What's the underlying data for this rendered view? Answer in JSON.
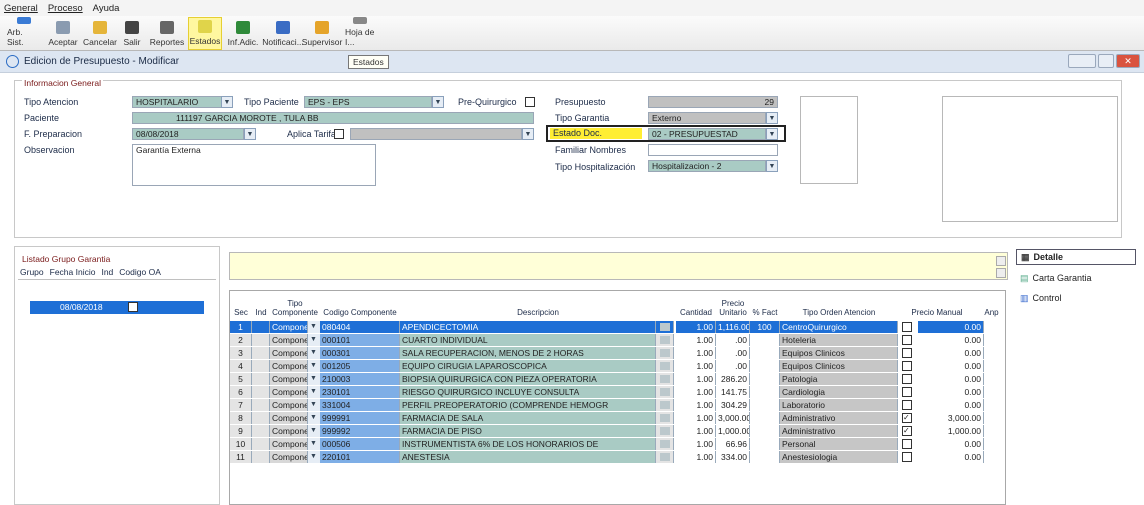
{
  "menu": [
    "General",
    "Proceso",
    "Ayuda"
  ],
  "toolbar": [
    {
      "label": "Arb. Sist.",
      "icon": "tree-icon",
      "color": "#3a7bd5"
    },
    {
      "label": "Aceptar",
      "icon": "accept-icon",
      "color": "#8a9bb0"
    },
    {
      "label": "Cancelar",
      "icon": "undo-icon",
      "color": "#e5b53a"
    },
    {
      "label": "Salir",
      "icon": "exit-icon",
      "color": "#444"
    },
    {
      "label": "Reportes",
      "icon": "report-icon",
      "color": "#666"
    },
    {
      "label": "Estados",
      "icon": "states-icon",
      "color": "#e0d44a",
      "active": true
    },
    {
      "label": "Inf.Adic.",
      "icon": "info-grid-icon",
      "color": "#2f8a3a"
    },
    {
      "label": "Notificaci...",
      "icon": "notification-icon",
      "color": "#3a6cc4"
    },
    {
      "label": "Supervisor",
      "icon": "supervisor-icon",
      "color": "#e5a42a"
    },
    {
      "label": "Hoja de I...",
      "icon": "sheet-icon",
      "color": "#888"
    }
  ],
  "window": {
    "title": "Edicion de Presupuesto - Modificar",
    "tooltip": "Estados"
  },
  "info": {
    "group_title": "Informacion General",
    "tipo_atencion_label": "Tipo Atencion",
    "tipo_atencion": "HOSPITALARIO",
    "tipo_paciente_label": "Tipo Paciente",
    "tipo_paciente": "EPS - EPS",
    "pre_quirurgico_label": "Pre-Quirurgico",
    "paciente_label": "Paciente",
    "paciente_id": "111197",
    "paciente_nombre": "GARCIA MOROTE , TULA BB",
    "f_preparacion_label": "F. Preparacion",
    "f_preparacion": "08/08/2018",
    "aplica_tarifa_label": "Aplica Tarifa",
    "observacion_label": "Observacion",
    "observacion": "Garantía Externa",
    "presupuesto_label": "Presupuesto",
    "presupuesto": "29",
    "tipo_garantia_label": "Tipo Garantia",
    "tipo_garantia": "Externo",
    "estado_doc_label": "Estado Doc.",
    "estado_doc": "02 - PRESUPUESTAD",
    "familiar_label": "Familiar Nombres",
    "familiar": "",
    "tipo_hosp_label": "Tipo Hospitalización",
    "tipo_hosp": "Hospitalizacion - 2"
  },
  "left": {
    "title": "Listado Grupo Garantia",
    "headers": [
      "Grupo",
      "Fecha Inicio",
      "Ind",
      "Codigo OA"
    ],
    "row_date": "08/08/2018"
  },
  "grid": {
    "headers": [
      "Sec",
      "Ind",
      "Tipo Componente",
      "Codigo Componente",
      "Descripcion",
      "Cantidad",
      "Precio Unitario",
      "% Fact",
      "Tipo Orden Atencion",
      "Precio Manual",
      "Anp"
    ],
    "rows": [
      {
        "sec": "1",
        "tipo": "Componen",
        "codigo": "080404",
        "desc": "APENDICECTOMIA",
        "cant": "1.00",
        "precio": "1,116.00",
        "fact": "100",
        "orden": "CentroQuirurgico",
        "manual": false,
        "monto": "0.00"
      },
      {
        "sec": "2",
        "tipo": "Componen",
        "codigo": "000101",
        "desc": "CUARTO INDIVIDUAL",
        "cant": "1.00",
        "precio": ".00",
        "fact": "",
        "orden": "Hoteleria",
        "manual": false,
        "monto": "0.00"
      },
      {
        "sec": "3",
        "tipo": "Componen",
        "codigo": "000301",
        "desc": "SALA RECUPERACION, MENOS DE 2 HORAS",
        "cant": "1.00",
        "precio": ".00",
        "fact": "",
        "orden": "Equipos Clinicos",
        "manual": false,
        "monto": "0.00"
      },
      {
        "sec": "4",
        "tipo": "Componen",
        "codigo": "001205",
        "desc": "EQUIPO CIRUGIA LAPAROSCOPICA",
        "cant": "1.00",
        "precio": ".00",
        "fact": "",
        "orden": "Equipos Clinicos",
        "manual": false,
        "monto": "0.00"
      },
      {
        "sec": "5",
        "tipo": "Componen",
        "codigo": "210003",
        "desc": "BIOPSIA QUIRURGICA CON PIEZA OPERATORIA",
        "cant": "1.00",
        "precio": "286.20",
        "fact": "",
        "orden": "Patologia",
        "manual": false,
        "monto": "0.00"
      },
      {
        "sec": "6",
        "tipo": "Componen",
        "codigo": "230101",
        "desc": "RIESGO QUIRURGICO INCLUYE CONSULTA",
        "cant": "1.00",
        "precio": "141.75",
        "fact": "",
        "orden": "Cardiologia",
        "manual": false,
        "monto": "0.00"
      },
      {
        "sec": "7",
        "tipo": "Componen",
        "codigo": "331004",
        "desc": "PERFIL PREOPERATORIO (COMPRENDE HEMOGR",
        "cant": "1.00",
        "precio": "304.29",
        "fact": "",
        "orden": "Laboratorio",
        "manual": false,
        "monto": "0.00"
      },
      {
        "sec": "8",
        "tipo": "Componen",
        "codigo": "999991",
        "desc": "FARMACIA DE SALA",
        "cant": "1.00",
        "precio": "3,000.00",
        "fact": "",
        "orden": "Administrativo",
        "manual": true,
        "monto": "3,000.00"
      },
      {
        "sec": "9",
        "tipo": "Componen",
        "codigo": "999992",
        "desc": "FARMACIA DE PISO",
        "cant": "1.00",
        "precio": "1,000.00",
        "fact": "",
        "orden": "Administrativo",
        "manual": true,
        "monto": "1,000.00"
      },
      {
        "sec": "10",
        "tipo": "Componen",
        "codigo": "000506",
        "desc": "   INSTRUMENTISTA 6% DE LOS HONORARIOS DE",
        "cant": "1.00",
        "precio": "66.96",
        "fact": "",
        "orden": "Personal",
        "manual": false,
        "monto": "0.00"
      },
      {
        "sec": "11",
        "tipo": "Componen",
        "codigo": "220101",
        "desc": "   ANESTESIA",
        "cant": "1.00",
        "precio": "334.00",
        "fact": "",
        "orden": "Anestesiologia",
        "manual": false,
        "monto": "0.00"
      }
    ]
  },
  "right_buttons": [
    "Detalle",
    "Carta Garantia",
    "Control"
  ]
}
